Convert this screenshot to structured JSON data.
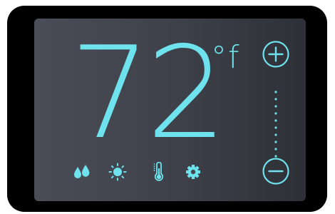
{
  "display": {
    "temperature": "72",
    "unit": "°f"
  },
  "controls": {
    "increase_icon": "plus-circle",
    "decrease_icon": "minus-circle",
    "setpoint_track_dots": 10
  },
  "mode_icons": [
    {
      "name": "humidity",
      "icon": "water-drops"
    },
    {
      "name": "weather",
      "icon": "sun"
    },
    {
      "name": "temperature",
      "icon": "thermometer"
    },
    {
      "name": "settings",
      "icon": "gear"
    }
  ],
  "colors": {
    "accent": "#6ee3ee",
    "bezel": "#000000",
    "screen_left": "#4a4c57",
    "screen_right": "#2e3037"
  }
}
